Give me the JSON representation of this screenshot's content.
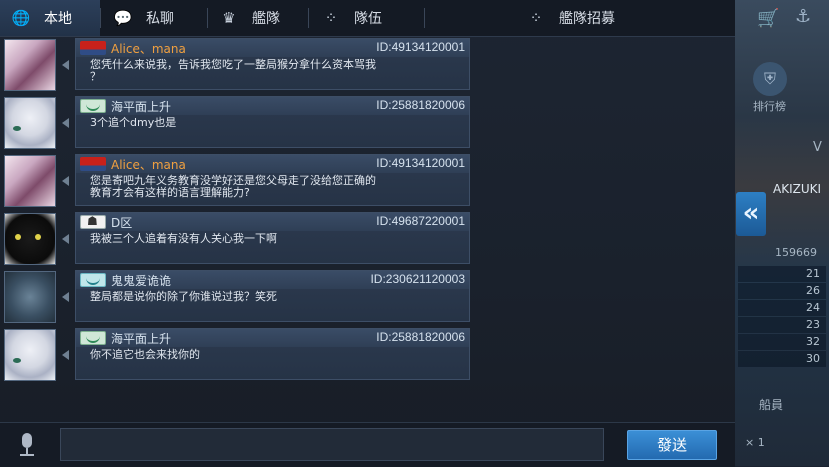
{
  "tabs": [
    {
      "label": "本地",
      "icon": "globe-icon",
      "active": true
    },
    {
      "label": "私聊",
      "icon": "chat-bubbles-icon",
      "active": false
    },
    {
      "label": "艦隊",
      "icon": "fleet-emblem-icon",
      "active": false
    },
    {
      "label": "隊伍",
      "icon": "team-dots-icon",
      "active": false
    },
    {
      "label": "艦隊招募",
      "icon": "recruit-dots-icon",
      "active": false
    }
  ],
  "messages": [
    {
      "name": "Alice、mana",
      "name_color": "#f0a040",
      "id": "ID:49134120001",
      "flag": "red",
      "avatar": "anime-girl-dark",
      "text": "您凭什么来说我，告诉我您吃了一整局猴分拿什么资本骂我\n？"
    },
    {
      "name": "海平面上升",
      "name_color": "#d6e2ee",
      "id": "ID:25881820006",
      "flag": "green",
      "avatar": "anime-girl-silver",
      "text": "3个追个dmy也是"
    },
    {
      "name": "Alice、mana",
      "name_color": "#f0a040",
      "id": "ID:49134120001",
      "flag": "red",
      "avatar": "anime-girl-dark",
      "text": "您是寄吧九年义务教育没学好还是您父母走了没给您正确的\n教育才会有这样的语言理解能力?"
    },
    {
      "name": "D区",
      "name_color": "#d6e2ee",
      "id": "ID:49687220001",
      "flag": "white",
      "avatar": "black-cat",
      "text": "我被三个人追着有没有人关心我一下啊"
    },
    {
      "name": "鬼鬼爱诡诡",
      "name_color": "#d6e2ee",
      "id": "ID:230621120003",
      "flag": "cyan",
      "avatar": "warship-scope",
      "text": "整局都是说你的除了你谁说过我？笑死"
    },
    {
      "name": "海平面上升",
      "name_color": "#d6e2ee",
      "id": "ID:25881820006",
      "flag": "green",
      "avatar": "anime-girl-silver",
      "text": "你不追它也会来找你的"
    }
  ],
  "input": {
    "value": ""
  },
  "send_button": {
    "label": "發送"
  },
  "right_panel": {
    "label_ranking": "排行榜",
    "label_ship_a": "V",
    "label_ship_name": "AKIZUKI",
    "label_score": "159669",
    "stats": [
      "21",
      "26",
      "24",
      "23",
      "32",
      "30"
    ],
    "label_bottom": "船員",
    "label_count": "× 1"
  },
  "colors": {
    "accent": "#2f82cc",
    "name_orange": "#f0a040"
  }
}
